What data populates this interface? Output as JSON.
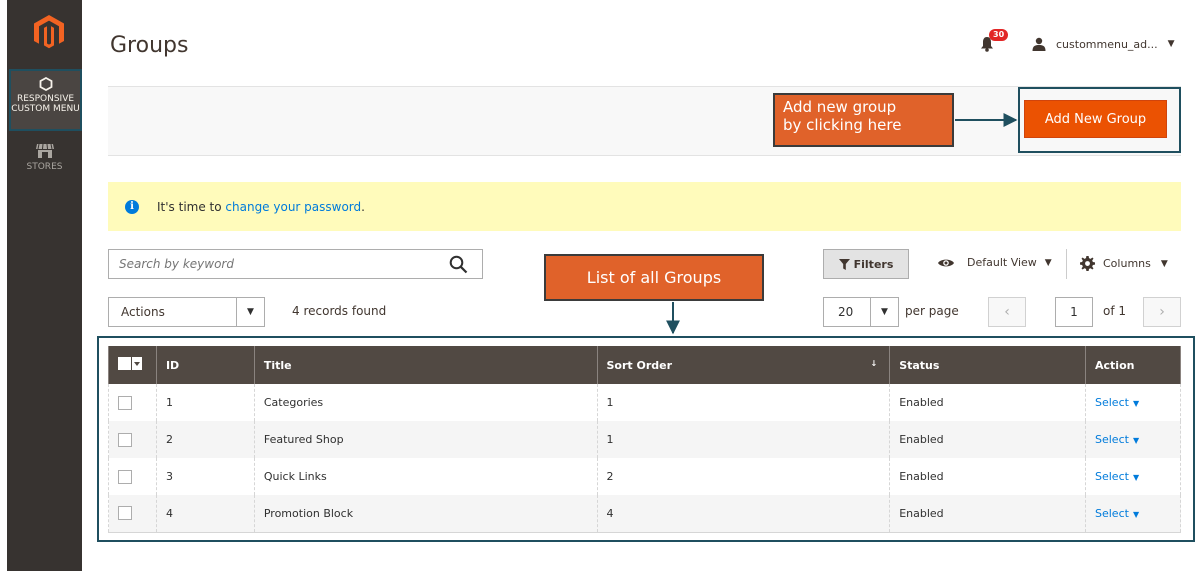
{
  "sidebar": {
    "items": [
      {
        "label_line1": "RESPONSIVE",
        "label_line2": "CUSTOM MENU",
        "icon": "hexagon-icon"
      },
      {
        "label_line1": "STORES",
        "icon": "store-icon"
      }
    ]
  },
  "header": {
    "title": "Groups",
    "notifications_count": "30",
    "user_name": "custommenu_ad...",
    "caret": "▼"
  },
  "action_bar": {
    "add_label": "Add New Group"
  },
  "callouts": {
    "add_line1": "Add new group",
    "add_line2": "by clicking here",
    "list": "List of all Groups"
  },
  "notice": {
    "prefix": "It's time to ",
    "link": "change your password",
    "suffix": ".",
    "icon_glyph": "i"
  },
  "search": {
    "placeholder": "Search by keyword"
  },
  "toolbar": {
    "filters_label": "Filters",
    "view_label": "Default View",
    "columns_label": "Columns"
  },
  "actions": {
    "label": "Actions",
    "records": "4 records found"
  },
  "pagination": {
    "per_page_value": "20",
    "per_page_label": "per page",
    "prev": "‹",
    "next": "›",
    "current": "1",
    "of_label": "of 1"
  },
  "table": {
    "columns": [
      "ID",
      "Title",
      "Sort Order",
      "Status",
      "Action"
    ],
    "sort_indicator": "↓",
    "rows": [
      {
        "id": "1",
        "title": "Categories",
        "sort": "1",
        "status": "Enabled",
        "action": "Select"
      },
      {
        "id": "2",
        "title": "Featured Shop",
        "sort": "1",
        "status": "Enabled",
        "action": "Select"
      },
      {
        "id": "3",
        "title": "Quick Links",
        "sort": "2",
        "status": "Enabled",
        "action": "Select"
      },
      {
        "id": "4",
        "title": "Promotion Block",
        "sort": "4",
        "status": "Enabled",
        "action": "Select"
      }
    ]
  },
  "colors": {
    "sidebar_bg": "#373330",
    "accent_orange": "#eb5202",
    "callout_orange": "#e0622a",
    "frame_teal": "#1f4f5f",
    "table_header": "#514943",
    "link_blue": "#007bdb",
    "notice_bg": "#fffbbb"
  }
}
